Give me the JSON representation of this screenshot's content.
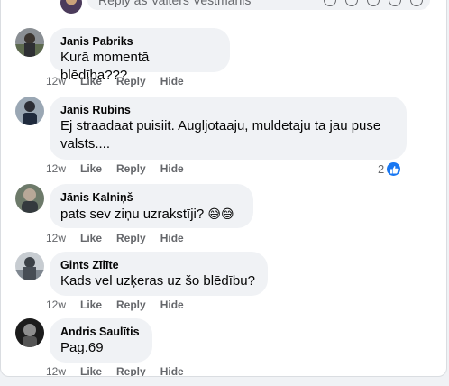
{
  "reply": {
    "placeholder": "Reply as Valters Vestmanis"
  },
  "comments": [
    {
      "author": "Janis Pabriks",
      "text": "Kurā momentā blēdība???",
      "time": "12w",
      "like": "Like",
      "reply": "Reply",
      "hide": "Hide"
    },
    {
      "author": "Janis Rubins",
      "text_line1": "Ej straadaat puisiit. Augljotaaju, muldetaju ta jau puse",
      "text_line2": "valsts....",
      "time": "12w",
      "like": "Like",
      "reply": "Reply",
      "hide": "Hide",
      "reaction_count": "2",
      "reaction_icon": "thumbs-up-icon"
    },
    {
      "author": "Jānis Kalniņš",
      "text": "pats sev ziņu uzrakstīji?",
      "emojis": "😅😅",
      "time": "12w",
      "like": "Like",
      "reply": "Reply",
      "hide": "Hide"
    },
    {
      "author": "Gints Zīlīte",
      "text": "Kads vel uzķeras uz šo blēdību?",
      "time": "12w",
      "like": "Like",
      "reply": "Reply",
      "hide": "Hide"
    },
    {
      "author": "Andris Saulītis",
      "text": "Pag.69",
      "time": "12w",
      "like": "Like",
      "reply": "Reply",
      "hide": "Hide"
    }
  ],
  "colors": {
    "bubble": "#f0f2f5",
    "meta_text": "#65676b",
    "like_blue": "#1877f2"
  }
}
